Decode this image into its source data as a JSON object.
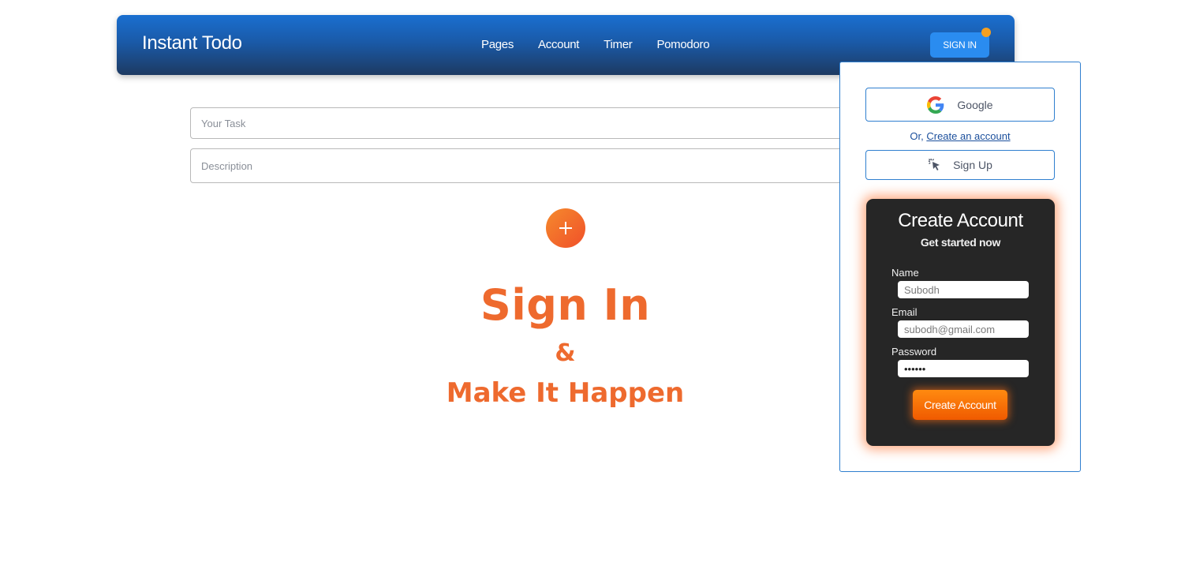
{
  "header": {
    "brand": "Instant Todo",
    "nav": [
      "Pages",
      "Account",
      "Timer",
      "Pomodoro"
    ],
    "signin_label": "SIGN IN",
    "accent": "#2a8cf0",
    "notification_dot_color": "#f5a020"
  },
  "form": {
    "task_placeholder": "Your Task",
    "description_placeholder": "Description",
    "add_icon": "plus-icon"
  },
  "hero": {
    "line1": "Sign In",
    "line2": "&",
    "line3": "Make It Happen",
    "color": "#ee6a2e"
  },
  "auth_panel": {
    "google_label": "Google",
    "or_text": "Or, ",
    "create_link": "Create an account",
    "signup_label": "Sign Up",
    "card": {
      "title": "Create Account",
      "subtitle": "Get started now",
      "name_label": "Name",
      "name_value": "Subodh",
      "email_label": "Email",
      "email_value": "subodh@gmail.com",
      "password_label": "Password",
      "password_value": "subodh",
      "submit_label": "Create Account"
    }
  }
}
